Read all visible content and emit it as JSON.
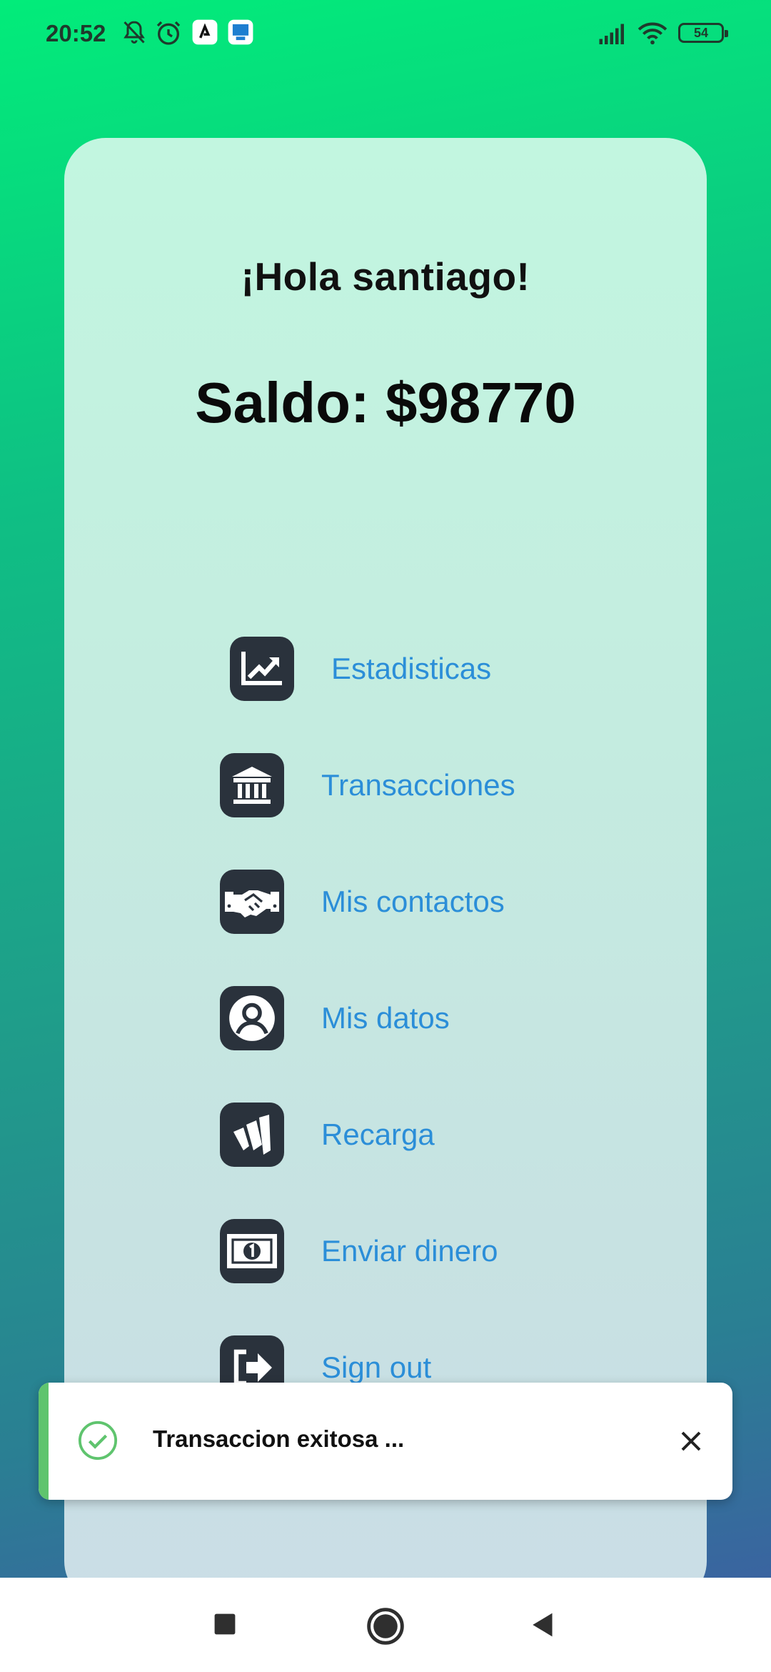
{
  "status_bar": {
    "time": "20:52",
    "battery": "54",
    "icons": [
      "bell-off-icon",
      "alarm-icon",
      "app-notification-icon",
      "app-notification-icon-2",
      "signal-icon",
      "wifi-icon",
      "battery-icon"
    ]
  },
  "home": {
    "greeting": "¡Hola santiago!",
    "balance": "Saldo: $98770",
    "menu": [
      {
        "label": "Estadisticas",
        "icon": "chart-line-icon"
      },
      {
        "label": "Transacciones",
        "icon": "bank-icon"
      },
      {
        "label": "Mis contactos",
        "icon": "handshake-icon"
      },
      {
        "label": "Mis datos",
        "icon": "user-circle-icon"
      },
      {
        "label": "Recarga",
        "icon": "wallet-icon"
      },
      {
        "label": "Enviar dinero",
        "icon": "money-bill-icon"
      },
      {
        "label": "Sign out",
        "icon": "sign-out-icon"
      }
    ]
  },
  "toast": {
    "message": "Transaccion exitosa ...",
    "accent_color": "#5fc46e"
  },
  "nav_bar": {
    "buttons": [
      "recents-button",
      "home-button",
      "back-button"
    ]
  },
  "colors": {
    "link": "#2b8ed8",
    "icon_bg": "#2a323c"
  }
}
